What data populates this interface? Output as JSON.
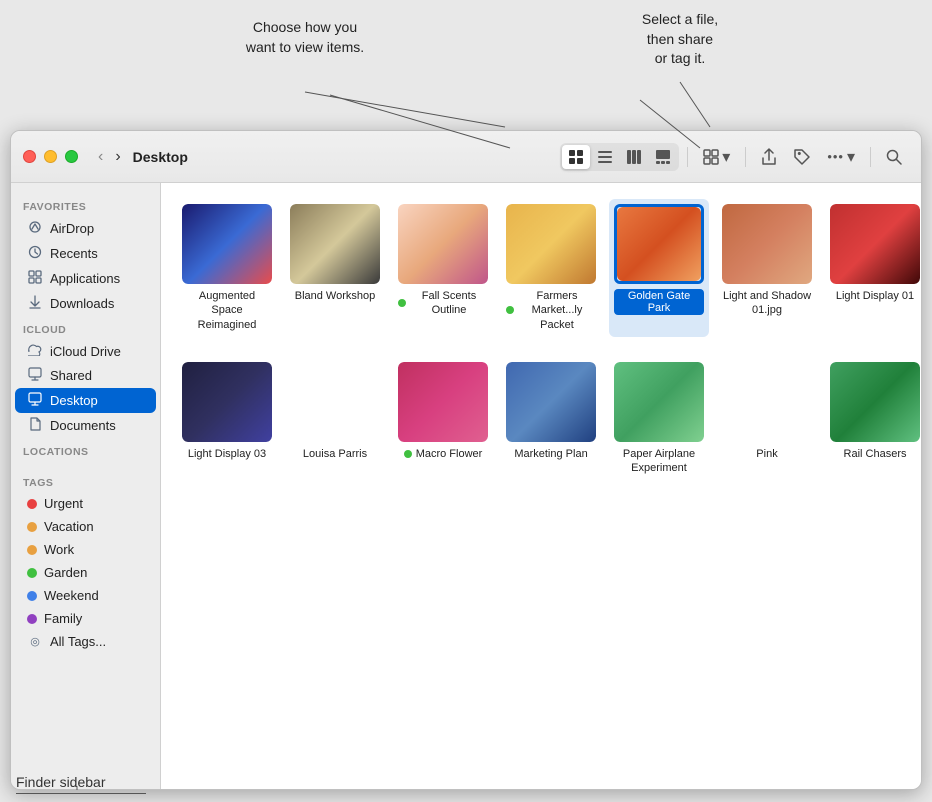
{
  "annotations": {
    "view_items": "Choose how you\nwant to view items.",
    "share_tag": "Select a file,\nthen share\nor tag it.",
    "finder_sidebar": "Finder sidebar"
  },
  "window": {
    "title": "Desktop"
  },
  "toolbar": {
    "back_label": "‹",
    "forward_label": "›",
    "view_icon_grid": "⊞",
    "view_icon_list": "☰",
    "view_icon_columns": "⬡",
    "view_icon_gallery": "▣",
    "group_label": "⊟",
    "share_label": "⬆",
    "tag_label": "⌁",
    "more_label": "•••",
    "search_label": "⌕"
  },
  "sidebar": {
    "sections": [
      {
        "label": "Favorites",
        "items": [
          {
            "id": "airdrop",
            "icon": "wifi",
            "label": "AirDrop",
            "active": false
          },
          {
            "id": "recents",
            "icon": "clock",
            "label": "Recents",
            "active": false
          },
          {
            "id": "applications",
            "icon": "grid",
            "label": "Applications",
            "active": false
          },
          {
            "id": "downloads",
            "icon": "arrow-down",
            "label": "Downloads",
            "active": false
          }
        ]
      },
      {
        "label": "iCloud",
        "items": [
          {
            "id": "icloud-drive",
            "icon": "cloud",
            "label": "iCloud Drive",
            "active": false
          },
          {
            "id": "shared",
            "icon": "shared",
            "label": "Shared",
            "active": false
          },
          {
            "id": "desktop",
            "icon": "desktop",
            "label": "Desktop",
            "active": true
          },
          {
            "id": "documents",
            "icon": "doc",
            "label": "Documents",
            "active": false
          }
        ]
      },
      {
        "label": "Locations",
        "items": []
      },
      {
        "label": "Tags",
        "items": [
          {
            "id": "urgent",
            "label": "Urgent",
            "color": "#e84040"
          },
          {
            "id": "vacation",
            "label": "Vacation",
            "color": "#e8a040"
          },
          {
            "id": "work",
            "label": "Work",
            "color": "#e8a040"
          },
          {
            "id": "garden",
            "label": "Garden",
            "color": "#40c040"
          },
          {
            "id": "weekend",
            "label": "Weekend",
            "color": "#4080e8"
          },
          {
            "id": "family",
            "label": "Family",
            "color": "#9040c0"
          },
          {
            "id": "all-tags",
            "label": "All Tags...",
            "color": null
          }
        ]
      }
    ]
  },
  "files": [
    {
      "id": "augmented",
      "name": "Augmented Space Reimagined",
      "thumb_class": "thumb-augmented",
      "has_dot": false,
      "dot_color": null,
      "selected": false
    },
    {
      "id": "bland-workshop",
      "name": "Bland Workshop",
      "thumb_class": "thumb-bland",
      "has_dot": false,
      "dot_color": null,
      "selected": false
    },
    {
      "id": "fall-scents",
      "name": "Fall Scents Outline",
      "thumb_class": "thumb-fallscents",
      "has_dot": true,
      "dot_color": "#40c040",
      "selected": false
    },
    {
      "id": "farmers-market",
      "name": "Farmers Market...ly Packet",
      "thumb_class": "thumb-farmers",
      "has_dot": true,
      "dot_color": "#40c040",
      "selected": false
    },
    {
      "id": "golden-gate",
      "name": "Golden Gate Park",
      "thumb_class": "thumb-goldengate",
      "has_dot": false,
      "dot_color": null,
      "selected": true
    },
    {
      "id": "light-shadow",
      "name": "Light and Shadow 01.jpg",
      "thumb_class": "thumb-lightandshadow",
      "has_dot": false,
      "dot_color": null,
      "selected": false
    },
    {
      "id": "light-display-01",
      "name": "Light Display 01",
      "thumb_class": "thumb-lightdisplay01",
      "has_dot": false,
      "dot_color": null,
      "selected": false
    },
    {
      "id": "light-display-03",
      "name": "Light Display 03",
      "thumb_class": "thumb-lightdisplay03",
      "has_dot": false,
      "dot_color": null,
      "selected": false
    },
    {
      "id": "louisa-parris",
      "name": "Louisa Parris",
      "thumb_class": "thumb-louisaparris",
      "has_dot": false,
      "dot_color": null,
      "selected": false
    },
    {
      "id": "macro-flower",
      "name": "Macro Flower",
      "thumb_class": "thumb-macroflower",
      "has_dot": true,
      "dot_color": "#40c040",
      "selected": false
    },
    {
      "id": "marketing-plan",
      "name": "Marketing Plan",
      "thumb_class": "thumb-marketing",
      "has_dot": false,
      "dot_color": null,
      "selected": false
    },
    {
      "id": "paper-airplane",
      "name": "Paper Airplane Experiment",
      "thumb_class": "thumb-paperairplane",
      "has_dot": false,
      "dot_color": null,
      "selected": false
    },
    {
      "id": "pink",
      "name": "Pink",
      "thumb_class": "thumb-pink",
      "has_dot": false,
      "dot_color": null,
      "selected": false
    },
    {
      "id": "rail-chasers",
      "name": "Rail Chasers",
      "thumb_class": "thumb-railchasers",
      "has_dot": false,
      "dot_color": null,
      "selected": false
    }
  ]
}
